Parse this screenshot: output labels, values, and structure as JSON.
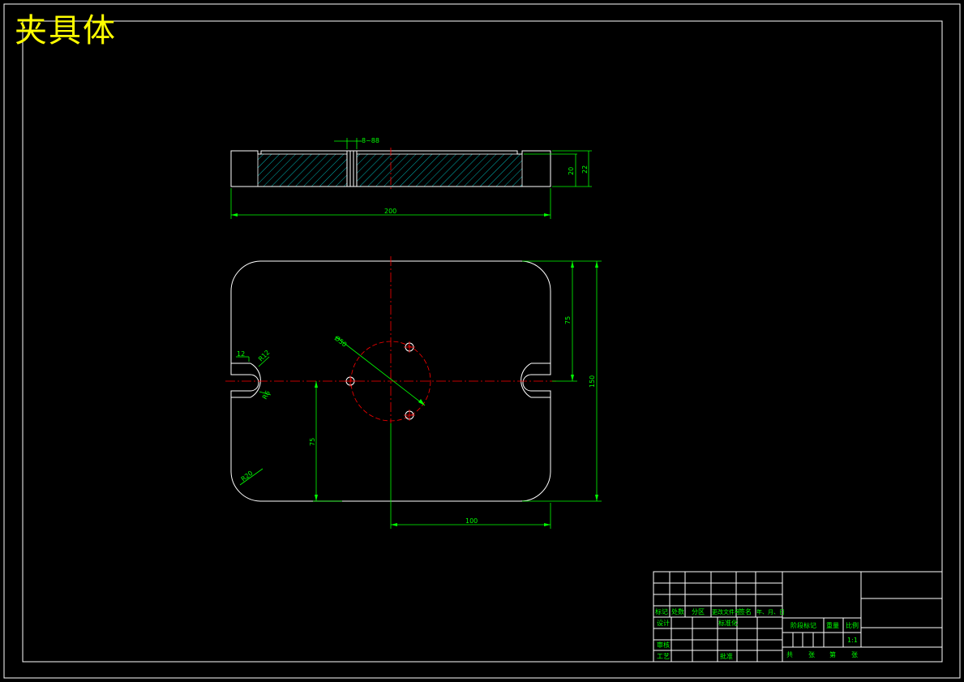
{
  "title": "夹具体",
  "colors": {
    "background": "#000000",
    "outline": "#ffffff",
    "dimension": "#00ff00",
    "centerline": "#ff0000",
    "hatch": "#00ffff",
    "title": "#ffff00"
  },
  "dimensions": {
    "top_view": {
      "slot_width": "8~88",
      "length": "200",
      "height_inner": "20",
      "height_outer": "22"
    },
    "plan_view": {
      "slot_width": "12",
      "slot_radius": "R12",
      "slot_radius2": "R6",
      "circle_dia": "Ø50",
      "corner_radius": "R20",
      "half_height_top": "75",
      "total_height": "150",
      "half_height_bottom": "75",
      "half_width": "100"
    }
  },
  "title_block": {
    "header_labels": [
      "标记",
      "处数",
      "分区",
      "更改文件号",
      "签名",
      "年、月、日"
    ],
    "row_design": "设计",
    "row_standard": "标准化",
    "row_check": "审核",
    "row_process": "工艺",
    "row_approve": "批准",
    "stage_label": "阶段标记",
    "weight_label": "重量",
    "scale_label": "比例",
    "scale_value": "1:1",
    "sheets": [
      "共",
      "张",
      "第",
      "张"
    ]
  }
}
